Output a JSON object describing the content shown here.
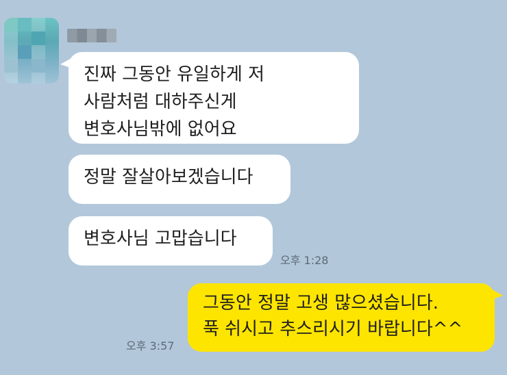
{
  "incoming": {
    "messages": [
      "진짜 그동안 유일하게 저\n사람처럼 대하주신게\n변호사님밖에 없어요",
      "정말 잘살아보겠습니다",
      "변호사님 고맙습니다"
    ],
    "time": "오후 1:28"
  },
  "outgoing": {
    "message": "그동안 정말 고생 많으셨습니다.\n푹 쉬시고 추스리시기 바랍니다^^",
    "time": "오후 3:57"
  },
  "colors": {
    "background": "#b2c7da",
    "incoming_bubble": "#ffffff",
    "outgoing_bubble": "#fee500"
  }
}
